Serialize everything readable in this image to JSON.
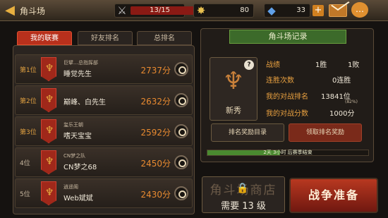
{
  "header": {
    "title": "角斗场",
    "stamina": "13/15",
    "stamina_fraction": 0.867,
    "gold": "80",
    "gems": "33"
  },
  "tabs": [
    {
      "label": "我的联赛",
      "active": true
    },
    {
      "label": "好友排名",
      "active": false
    },
    {
      "label": "总排名",
      "active": false
    }
  ],
  "league": [
    {
      "rank": "第1位",
      "guild": "巨擘…总指挥部",
      "name": "睡觉先生",
      "score": "2737分"
    },
    {
      "rank": "第2位",
      "guild": "",
      "name": "巅峰、白先生",
      "score": "2632分"
    },
    {
      "rank": "第3位",
      "guild": "玺乐王朝",
      "name": "嗜天宝宝",
      "score": "2592分"
    },
    {
      "rank": "4位",
      "guild": "CN梦之队",
      "name": "CN梦之68",
      "score": "2450分"
    },
    {
      "rank": "5位",
      "guild": "逍遥阁",
      "name": "Web斌斌",
      "score": "2430分"
    }
  ],
  "record": {
    "title": "角斗场记录",
    "tier": "新秀",
    "labels": {
      "record": "战绩",
      "streak": "连胜次数",
      "my_rank": "我的对战排名",
      "my_score": "我的对战分数"
    },
    "wins": "1胜",
    "losses": "1败",
    "streak": "0连胜",
    "rank": "13841位",
    "rank_percent": "(82%)",
    "score": "1000分",
    "btn_rewards_list": "排名奖励目录",
    "btn_claim": "领取排名奖励",
    "season_text": "2天 3小时 后赛季结束",
    "season_progress": 0.45
  },
  "shop": {
    "name": "角斗场商店",
    "requirement": "需要 13 级"
  },
  "battle_button": "战争准备"
}
